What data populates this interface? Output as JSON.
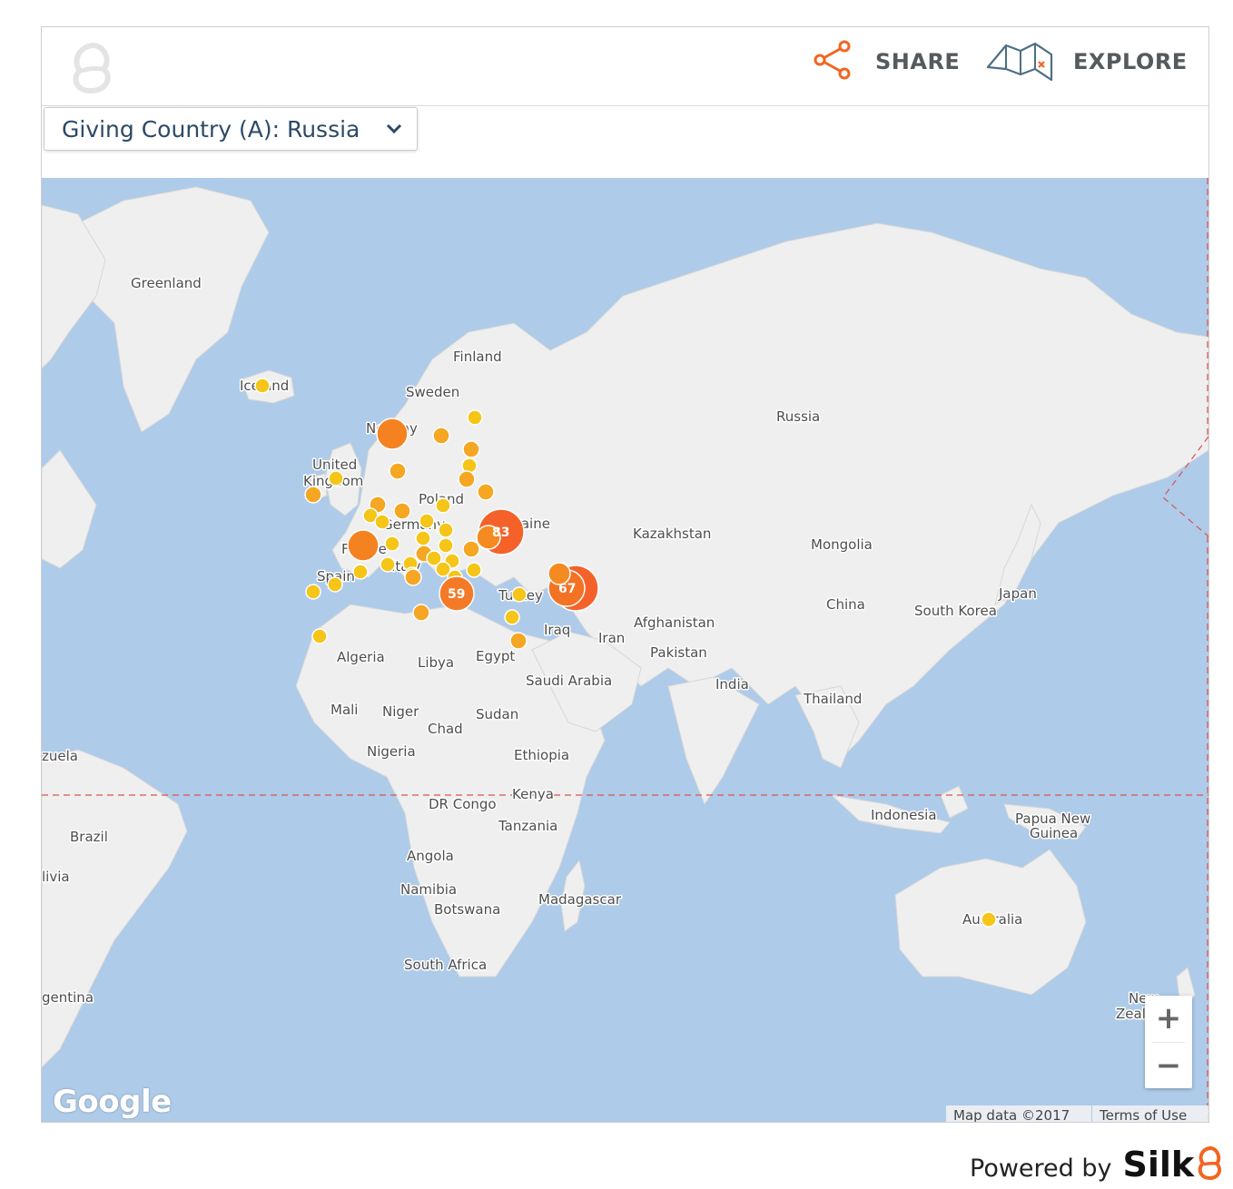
{
  "header": {
    "share_label": "SHARE",
    "explore_label": "EXPLORE",
    "icons": {
      "logo": "silk-logo-icon",
      "share": "share-icon",
      "explore": "map-icon"
    }
  },
  "filter": {
    "label": "Giving Country (A): Russia",
    "icon": "chevron-down-icon"
  },
  "map": {
    "country_labels": [
      "Greenland",
      "Finland",
      "Sweden",
      "Norway",
      "United",
      "Kingdom",
      "Poland",
      "Germany",
      "France",
      "Spain",
      "Italy",
      "Turkey",
      "Iceland",
      "Russia",
      "Kazakhstan",
      "Mongolia",
      "China",
      "Japan",
      "South Korea",
      "Afghanistan",
      "Iran",
      "Iraq",
      "Pakistan",
      "India",
      "Thailand",
      "Algeria",
      "Libya",
      "Egypt",
      "Saudi Arabia",
      "Mali",
      "Niger",
      "Chad",
      "Sudan",
      "Nigeria",
      "Ethiopia",
      "Kenya",
      "DR Congo",
      "Tanzania",
      "Angola",
      "Namibia",
      "Botswana",
      "Madagascar",
      "South Africa",
      "Indonesia",
      "Papua New",
      "Guinea",
      "Australia",
      "New",
      "Zeal",
      "Brazil",
      "livia",
      "zuela",
      "gentina",
      "Ukraine"
    ],
    "clusters": [
      {
        "count": "83",
        "color": "#f4622a"
      },
      {
        "count": "59",
        "color": "#f47a27"
      },
      {
        "count": "67",
        "color": "#f4622a"
      }
    ],
    "marker_colors": {
      "small": "#f5c518",
      "medium": "#f5a623",
      "large": "#f58220",
      "xlarge": "#f4622a"
    },
    "zoom_in": "+",
    "zoom_out": "−",
    "google_label": "Google",
    "map_data": "Map data ©2017",
    "terms": "Terms of Use"
  },
  "footer": {
    "powered_by": "Powered by",
    "brand": "Silk"
  }
}
